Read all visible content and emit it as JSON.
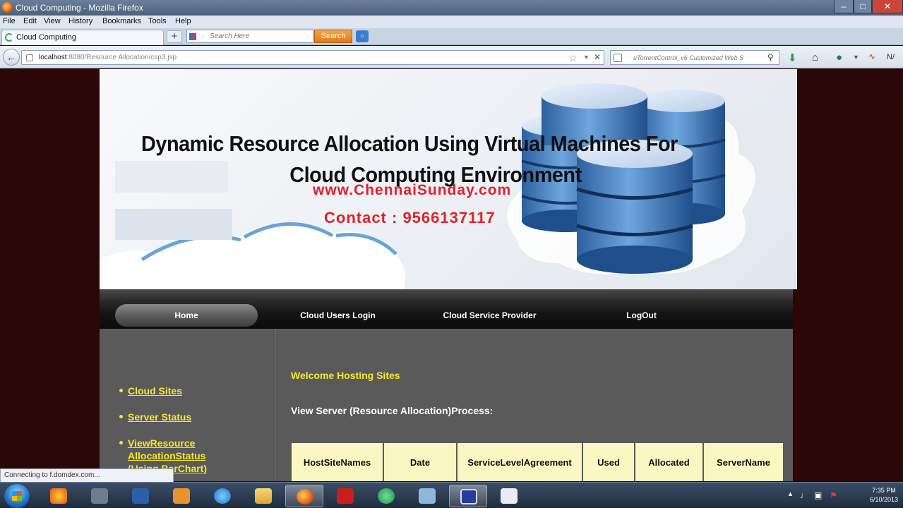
{
  "window": {
    "title": "Cloud Computing - Mozilla Firefox"
  },
  "menu": [
    "File",
    "Edit",
    "View",
    "History",
    "Bookmarks",
    "Tools",
    "Help"
  ],
  "tab": {
    "label": "Cloud Computing"
  },
  "tab_search": {
    "placeholder": "Search Here",
    "button": "Search"
  },
  "address": {
    "host": "localhost",
    "path": ":8080/Resource Allocation/csp3.jsp"
  },
  "side_search": {
    "text": "uTorrentControl_v6 Customized Web S"
  },
  "toolbar_right_text": "N/",
  "banner": {
    "headline_line1": "Dynamic Resource Allocation Using Virtual Machines For",
    "headline_line2": "Cloud Computing Environment",
    "website": "www.ChennaiSunday.com",
    "contact": "Contact : 9566137117"
  },
  "nav": {
    "home": "Home",
    "cloud_users_login": "Cloud Users Login",
    "cloud_service_provider": "Cloud Service Provider",
    "logout": "LogOut"
  },
  "sidebar": {
    "links": [
      "Cloud Sites",
      "Server Status",
      "ViewResource",
      "AllocationStatus",
      "(Using BarChart)"
    ]
  },
  "main": {
    "welcome": "Welcome Hosting Sites",
    "view_title": "View Server (Resource Allocation)Process:",
    "table_headers": [
      "HostSiteNames",
      "Date",
      "ServiceLevelAgreement",
      "Used",
      "Allocated",
      "ServerName"
    ]
  },
  "status_bar": "Connecting to f.domdex.com...",
  "clock": {
    "time": "7:35 PM",
    "date": "6/10/2013"
  },
  "colors": {
    "page_background": "#2b0707",
    "link_yellow": "#f5e72a",
    "accent_red": "#e0222a",
    "table_header_bg": "#fbf7c2",
    "content_gray": "#5a5a5a"
  }
}
